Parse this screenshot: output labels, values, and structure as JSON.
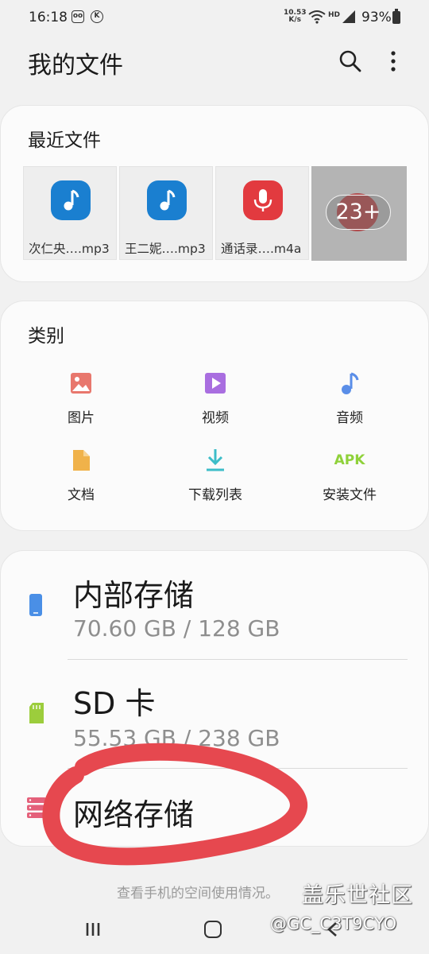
{
  "status_bar": {
    "time": "16:18",
    "net_speed_value": "10.53",
    "net_speed_unit": "K/s",
    "network_label": "HD",
    "battery": "93%"
  },
  "header": {
    "title": "我的文件"
  },
  "recent": {
    "title": "最近文件",
    "items": [
      {
        "name": "次仁央….mp3",
        "icon": "music-note-icon",
        "color": "#1a7fd0"
      },
      {
        "name": "王二妮….mp3",
        "icon": "music-note-icon",
        "color": "#1a7fd0"
      },
      {
        "name": "通话录….m4a",
        "icon": "microphone-icon",
        "color": "#e23a3f"
      }
    ],
    "more_label": "23+"
  },
  "category": {
    "title": "类别",
    "items": [
      {
        "label": "图片",
        "icon": "image-icon",
        "color": "#e8776d"
      },
      {
        "label": "视频",
        "icon": "video-icon",
        "color": "#a96ee0"
      },
      {
        "label": "音频",
        "icon": "audio-icon",
        "color": "#5a8ee8"
      },
      {
        "label": "文档",
        "icon": "document-icon",
        "color": "#f0b24a"
      },
      {
        "label": "下载列表",
        "icon": "download-icon",
        "color": "#3dbdc8"
      },
      {
        "label": "安装文件",
        "icon": "apk-icon",
        "apk_text": "APK",
        "color": "#8fd13a"
      }
    ]
  },
  "storage": {
    "items": [
      {
        "name": "内部存储",
        "size": "70.60 GB / 128 GB",
        "icon": "phone-icon",
        "color": "#4a8fe6"
      },
      {
        "name": "SD 卡",
        "size": "55.53 GB / 238 GB",
        "icon": "sd-card-icon",
        "color": "#9ccd3c"
      },
      {
        "name": "网络存储",
        "icon": "network-storage-icon",
        "color": "#e4607a"
      }
    ]
  },
  "footer": {
    "hint": "查看手机的空间使用情况。"
  },
  "watermark": {
    "brand": "盖乐世社区",
    "user": "@GC_C3T9CYO"
  }
}
